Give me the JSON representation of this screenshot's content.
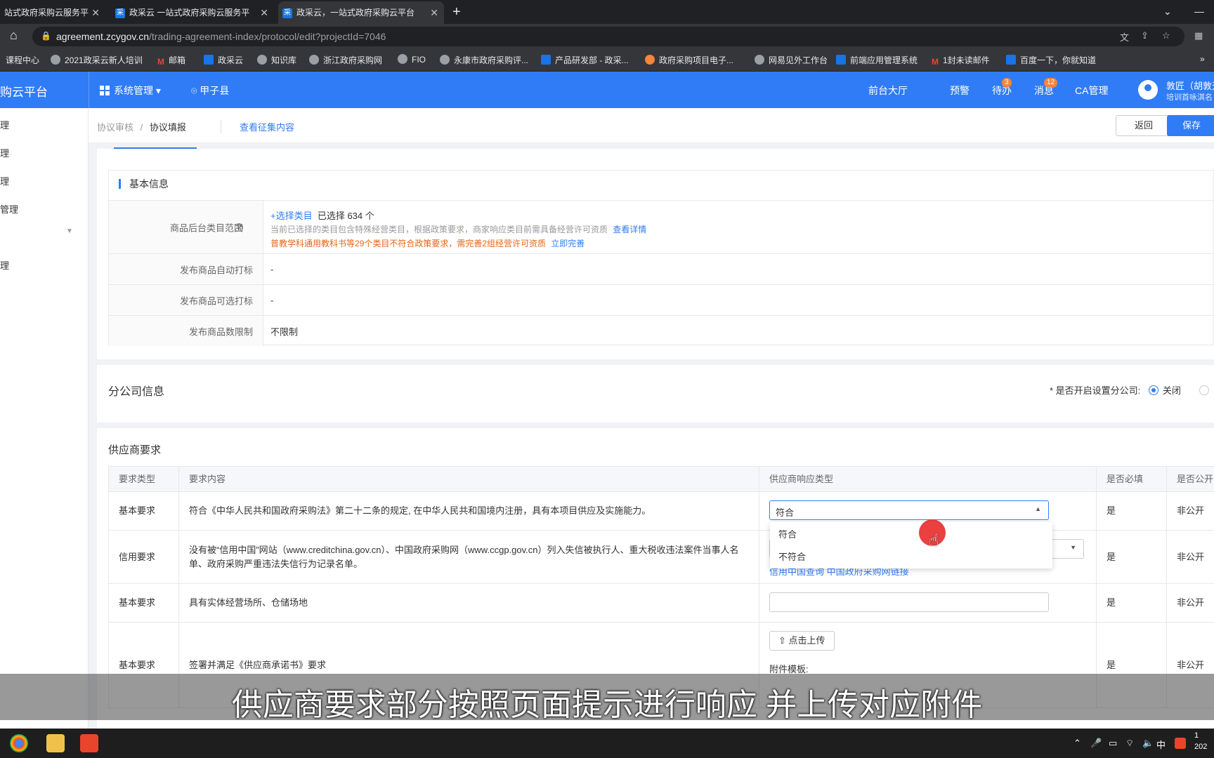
{
  "browser": {
    "tabs": [
      {
        "label": "站式政府采购云服务平",
        "active": false
      },
      {
        "label": "政采云 一站式政府采购云服务平",
        "active": false
      },
      {
        "label": "政采云，一站式政府采购云平台",
        "active": true
      }
    ],
    "url_host": "agreement.zcygov.cn",
    "url_path": "/trading-agreement-index/protocol/edit?projectId=7046",
    "bookmarks": [
      "课程中心",
      "2021政采云新人培训",
      "邮箱",
      "政采云",
      "知识库",
      "浙江政府采购网",
      "FIO",
      "永康市政府采购评...",
      "产品研发部 - 政采...",
      "政府采购项目电子...",
      "网易见外工作台",
      "前端应用管理系统",
      "1封未读邮件",
      "百度一下，你就知道"
    ]
  },
  "header": {
    "brand": "购云平台",
    "system_menu": "系统管理",
    "region": "甲子县",
    "nav": [
      {
        "label": "前台大厅",
        "badge": ""
      },
      {
        "label": "预警",
        "badge": ""
      },
      {
        "label": "待办",
        "badge": "3"
      },
      {
        "label": "消息",
        "badge": "12"
      },
      {
        "label": "CA管理",
        "badge": ""
      }
    ],
    "user_name": "敦匠（胡敦天",
    "user_org": "培训首咏淇名"
  },
  "sidebar": {
    "items": [
      "理",
      "理",
      "理",
      "管理",
      "",
      "理"
    ]
  },
  "subheader": {
    "breadcrumb_parent": "协议审核",
    "breadcrumb_sep": "/",
    "breadcrumb_current": "协议填报",
    "view_link": "查看征集内容",
    "back_label": "返回",
    "save_label": "保存"
  },
  "basic_info": {
    "title": "基本信息",
    "category_label": "商品后台类目范围",
    "select_category_link": "+选择类目",
    "selected_count_text": "已选择 634 个",
    "notice_text": "当前已选择的类目包含特殊经营类目，根据政策要求，商家响应类目前需具备经营许可资质",
    "notice_link": "查看详情",
    "warning_text": "普教学科通用教科书等29个类目不符合政策要求，需完善2组经营许可资质",
    "warning_link": "立即完善",
    "auto_tag_label": "发布商品自动打标",
    "auto_tag_value": "-",
    "optional_tag_label": "发布商品可选打标",
    "optional_tag_value": "-",
    "qty_limit_label": "发布商品数限制",
    "qty_limit_value": "不限制"
  },
  "branch": {
    "title": "分公司信息",
    "switch_label": "* 是否开启设置分公司:",
    "option_off": "关闭"
  },
  "supplier": {
    "title": "供应商要求",
    "columns": [
      "要求类型",
      "要求内容",
      "供应商响应类型",
      "是否必填",
      "是否公开"
    ],
    "rows": [
      {
        "type": "基本要求",
        "content": "符合《中华人民共和国政府采购法》第二十二条的规定, 在中华人民共和国境内注册，具有本项目供应及实施能力。",
        "response": "符合",
        "required": "是",
        "public": "非公开"
      },
      {
        "type": "信用要求",
        "content": "没有被“信用中国”网站（www.creditchina.gov.cn）、中国政府采购网（www.ccgp.gov.cn）列入失信被执行人、重大税收违法案件当事人名单、政府采购严重违法失信行为记录名单。",
        "links": "信用中国查询   中国政府采购网链接",
        "required": "是",
        "public": "非公开"
      },
      {
        "type": "基本要求",
        "content": "具有实体经营场所、仓储场地",
        "required": "是",
        "public": "非公开"
      },
      {
        "type": "基本要求",
        "content": "签署并满足《供应商承诺书》要求",
        "upload_label": "点击上传",
        "template_label": "附件模板:",
        "required": "是",
        "public": "非公开"
      }
    ],
    "dropdown_options": [
      "符合",
      "不符合"
    ]
  },
  "caption": "供应商要求部分按照页面提示进行响应 并上传对应附件",
  "taskbar": {
    "ime": "中",
    "clock_top": "1",
    "clock_bottom": "202"
  }
}
